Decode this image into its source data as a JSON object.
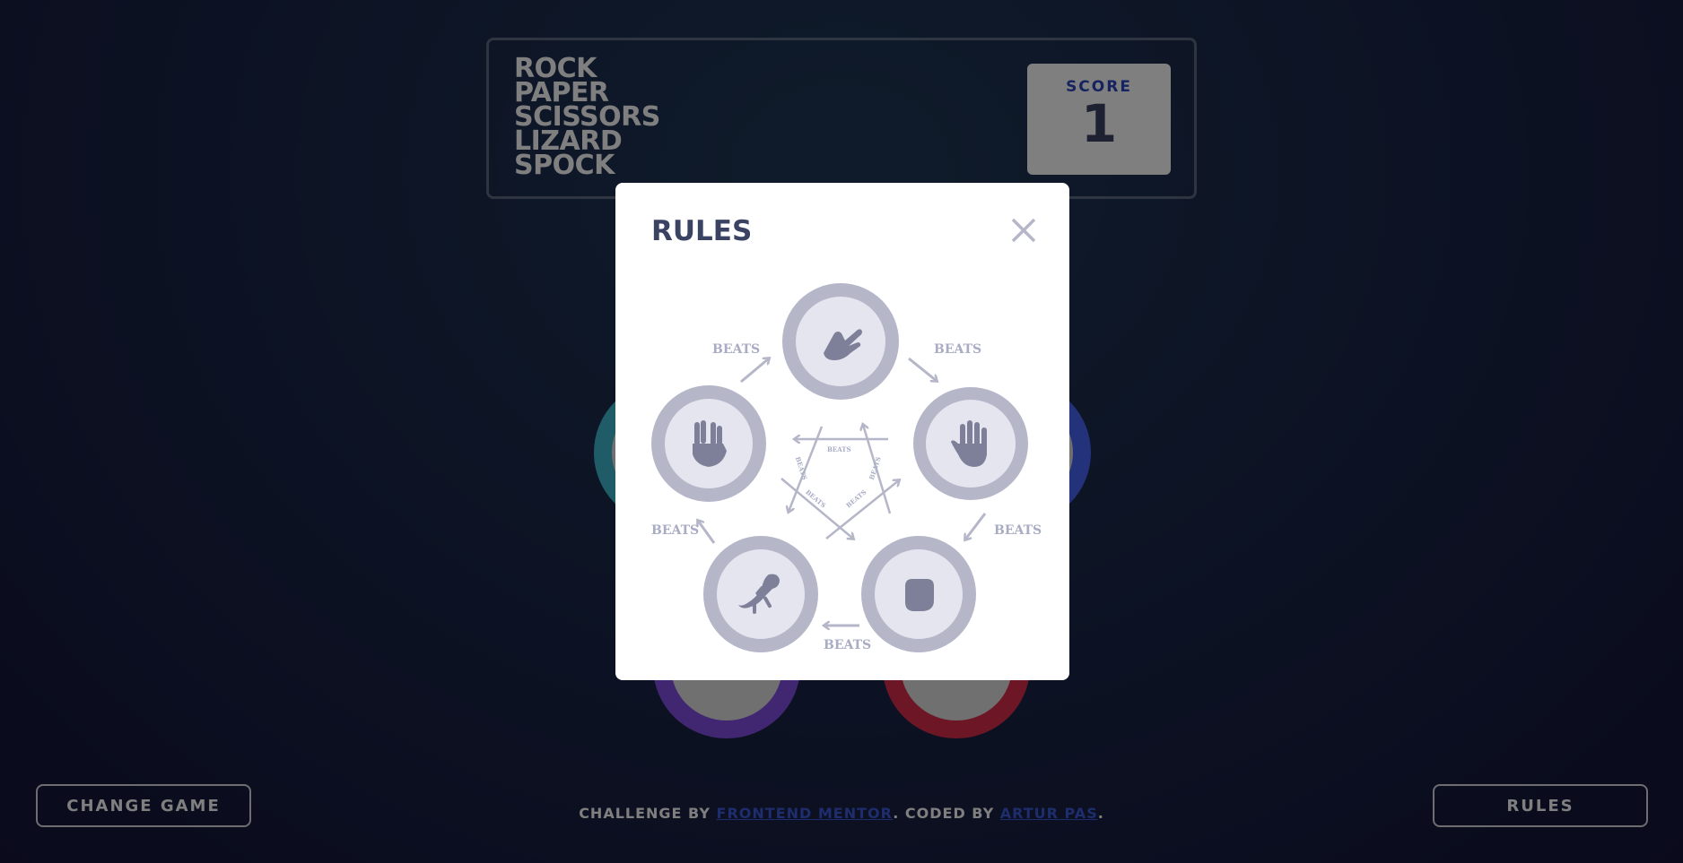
{
  "header": {
    "title_words": [
      "ROCK",
      "PAPER",
      "SCISSORS",
      "LIZARD",
      "SPOCK"
    ],
    "score_label": "SCORE",
    "score_value": "1"
  },
  "buttons": {
    "change_game": "CHANGE GAME",
    "rules": "RULES"
  },
  "footer": {
    "challenge_prefix": "CHALLENGE BY ",
    "challenge_link": "FRONTEND MENTOR",
    "coded_prefix": ". CODED BY ",
    "coded_link": "ARTUR PAS",
    "suffix": "."
  },
  "modal": {
    "title": "RULES",
    "beats_label": "BEATS",
    "outer_labels": [
      "BEATS",
      "BEATS",
      "BEATS",
      "BEATS",
      "BEATS"
    ],
    "inner_labels": [
      "BEATS",
      "BEATS",
      "BEATS",
      "BEATS",
      "BEATS"
    ],
    "moves": [
      {
        "name": "scissors",
        "icon": "scissors-hand-icon"
      },
      {
        "name": "paper",
        "icon": "paper-hand-icon"
      },
      {
        "name": "rock",
        "icon": "rock-fist-icon"
      },
      {
        "name": "lizard",
        "icon": "lizard-icon"
      },
      {
        "name": "spock",
        "icon": "spock-hand-icon"
      }
    ]
  },
  "colors": {
    "scissors": "#eca81e",
    "paper": "#4664f4",
    "rock": "#db2e4d",
    "lizard": "#834fe3",
    "spock": "#40b9ce",
    "modal_title": "#3b4363",
    "score_label": "#2a46c0",
    "diagram_grey": "#b5b7c9"
  }
}
